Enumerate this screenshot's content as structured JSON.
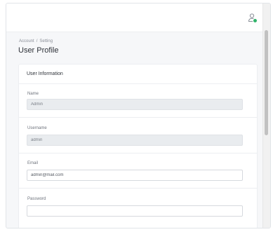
{
  "breadcrumb": {
    "items": [
      "Account",
      "Setting"
    ],
    "separator": "/"
  },
  "page": {
    "title": "User Profile"
  },
  "card": {
    "title": "User Information"
  },
  "fields": {
    "name": {
      "label": "Name",
      "value": "Admin",
      "readonly": true
    },
    "username": {
      "label": "Username",
      "value": "admin",
      "readonly": true
    },
    "email": {
      "label": "Email",
      "value": "admin@mail.com",
      "readonly": false
    },
    "password": {
      "label": "Password",
      "value": "",
      "readonly": false
    }
  },
  "header": {
    "user_icon": "user-icon",
    "status_color": "#2fb36a"
  }
}
